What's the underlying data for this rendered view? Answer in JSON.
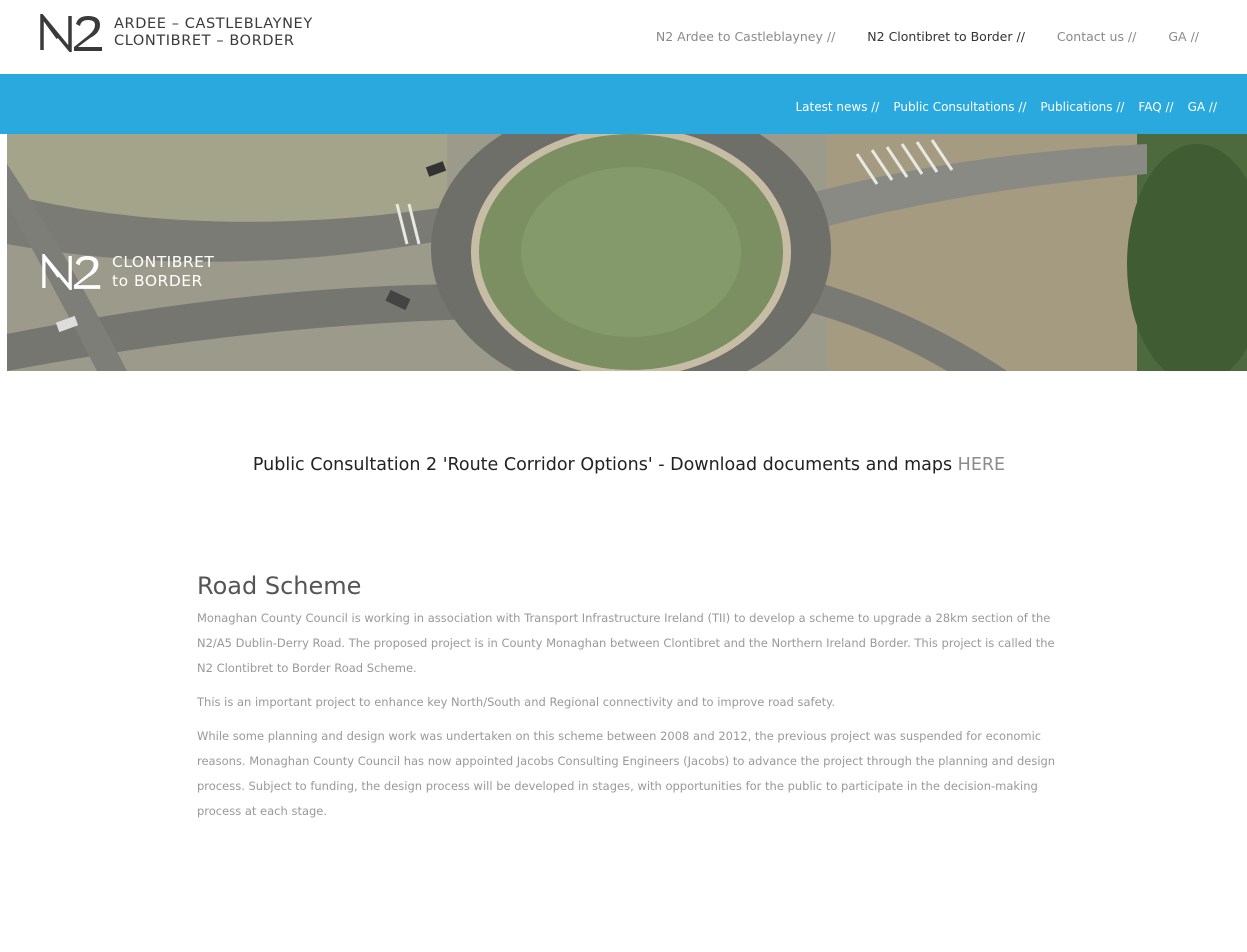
{
  "header": {
    "logo_line1": "ARDEE – CASTLEBLAYNEY",
    "logo_line2": "CLONTIBRET – BORDER",
    "nav": [
      {
        "label": "N2 Ardee to Castleblayney //",
        "active": false
      },
      {
        "label": "N2 Clontibret to Border //",
        "active": true
      },
      {
        "label": "Contact us //",
        "active": false
      },
      {
        "label": "GA //",
        "active": false
      }
    ]
  },
  "subnav": {
    "items": [
      "Latest news //",
      "Public Consultations //",
      "Publications //",
      "FAQ //",
      "GA //"
    ],
    "background": "#2aa9df"
  },
  "banner": {
    "logo_line1": "CLONTIBRET",
    "logo_line2": "to BORDER"
  },
  "notice": {
    "text": "Public Consultation 2 'Route Corridor Options' - Download documents and maps ",
    "link": "HERE"
  },
  "content": {
    "heading": "Road Scheme",
    "paragraphs": [
      "Monaghan County Council is working in association with Transport Infrastructure Ireland (TII) to develop a scheme to upgrade a 28km section of the N2/A5 Dublin-Derry Road. The proposed project is in County Monaghan between Clontibret and the Northern Ireland Border. This project is called the N2 Clontibret to Border Road Scheme.",
      "This is an important project to enhance key North/South and Regional connectivity and to improve road safety.",
      "While some planning and design work was undertaken on this scheme between 2008 and 2012, the previous project was suspended for economic reasons. Monaghan County Council has now appointed Jacobs Consulting Engineers (Jacobs) to advance the project through the planning and design process. Subject to funding, the design process will be developed in stages, with opportunities for the public to participate in the decision-making process at each stage."
    ]
  }
}
